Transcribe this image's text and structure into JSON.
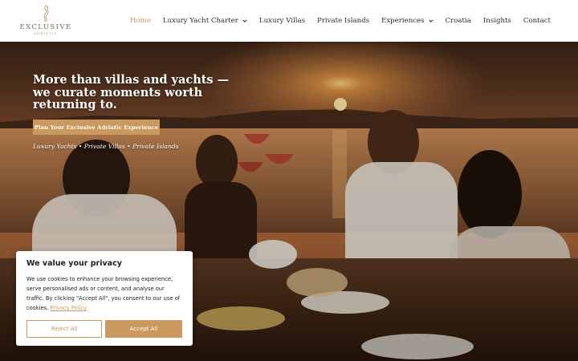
{
  "logo": {
    "title": "EXCLUSIVE",
    "subtitle": "ADRIATIC",
    "icon": "seahorse-icon"
  },
  "nav": {
    "items": [
      {
        "label": "Home",
        "active": true
      },
      {
        "label": "Luxury Yacht Charter",
        "dropdown": true
      },
      {
        "label": "Luxury Villas"
      },
      {
        "label": "Private Islands"
      },
      {
        "label": "Experiences",
        "dropdown": true
      },
      {
        "label": "Croatia"
      },
      {
        "label": "Insights"
      },
      {
        "label": "Contact"
      }
    ]
  },
  "hero": {
    "title": "More than villas and yachts — we curate moments worth returning to.",
    "cta_label": "Plan Your Exclusive Adriatic Experience",
    "tagline": "Luxury Yachts • Private Villas • Private Islands"
  },
  "cookie": {
    "title": "We value your privacy",
    "text": "We use cookies to enhance your browsing experience, serve personalised ads or content, and analyse our traffic. By clicking \"Accept All\", you consent to our use of cookies.",
    "link_label": "Privacy Policy",
    "reject_label": "Reject All",
    "accept_label": "Accept All"
  },
  "colors": {
    "accent": "#c9995d",
    "active_nav": "#c9955b",
    "text": "#2b2b2b"
  }
}
